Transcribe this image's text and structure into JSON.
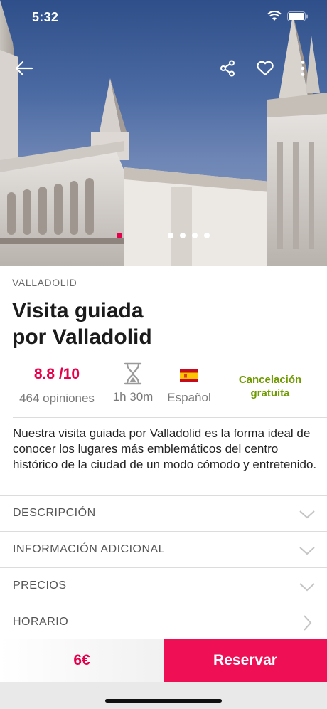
{
  "status_bar": {
    "time": "5:32"
  },
  "hero": {
    "icons": [
      "back-arrow-icon",
      "share-icon",
      "heart-icon",
      "more-vertical-icon"
    ],
    "carousel": {
      "count": 5,
      "active_index": 0
    }
  },
  "tour": {
    "location": "VALLADOLID",
    "title": "Visita guiada por Valladolid",
    "title_lines": [
      "Visita guiada",
      "por Valladolid"
    ],
    "rating": "8.8 /10",
    "reviews": "464 opiniones",
    "duration": "1h 30m",
    "language": "Español",
    "cancellation_lines": [
      "Cancelación",
      "gratuita"
    ],
    "summary": "Nuestra visita guiada por Valladolid es la forma ideal de conocer los lugares más emblemáticos del centro histórico de la ciudad de un modo cómodo y entretenido."
  },
  "sections": [
    {
      "label": "DESCRIPCIÓN",
      "icon": "chevron-down-icon"
    },
    {
      "label": "INFORMACIÓN ADICIONAL",
      "icon": "chevron-down-icon"
    },
    {
      "label": "PRECIOS",
      "icon": "chevron-down-icon"
    },
    {
      "label": "HORARIO",
      "icon": "chevron-right-icon"
    }
  ],
  "footer": {
    "price": "6€",
    "book_label": "Reservar"
  },
  "colors": {
    "accent": "#e6004c",
    "book_button": "#ef0f54",
    "cancellation": "#6f9a00"
  }
}
